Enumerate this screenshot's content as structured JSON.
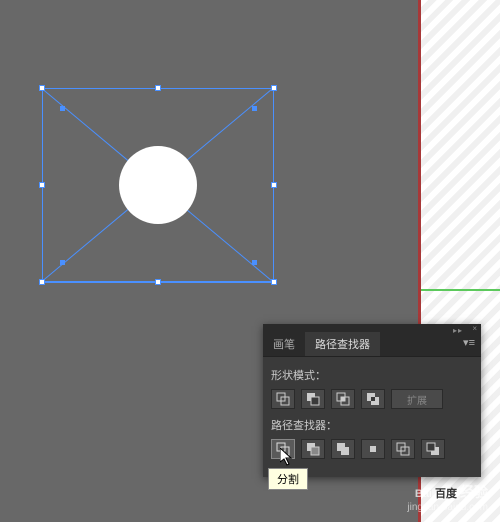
{
  "panel": {
    "tabs": {
      "brushes": "画笔",
      "pathfinder": "路径查找器"
    },
    "sections": {
      "shape_modes": "形状模式：",
      "pathfinders": "路径查找器："
    },
    "expand_button": "扩展",
    "tooltip": "分割"
  },
  "shape_mode_buttons": [
    {
      "name": "unite-icon"
    },
    {
      "name": "minus-front-icon"
    },
    {
      "name": "intersect-icon"
    },
    {
      "name": "exclude-icon"
    }
  ],
  "pathfinder_buttons": [
    {
      "name": "divide-icon"
    },
    {
      "name": "trim-icon"
    },
    {
      "name": "merge-icon"
    },
    {
      "name": "crop-icon"
    },
    {
      "name": "outline-icon"
    },
    {
      "name": "minus-back-icon"
    }
  ],
  "watermark": {
    "brand_prefix": "Bai",
    "brand_box": "百度",
    "brand_suffix": "经验",
    "url": "jingyan.baidu.com"
  }
}
